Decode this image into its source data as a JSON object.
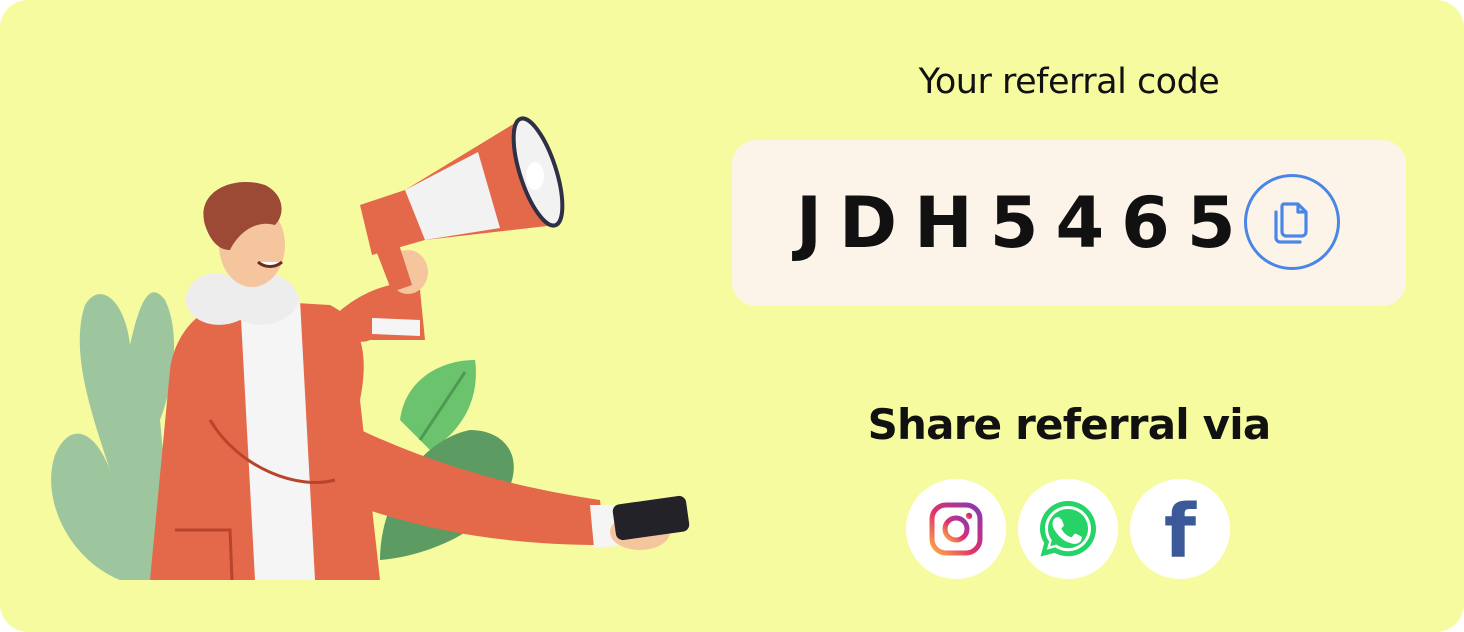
{
  "referral": {
    "heading": "Your referral code",
    "code": "JDH5465",
    "copy_icon": "copy-icon"
  },
  "share": {
    "heading": "Share referral via",
    "items": [
      {
        "name": "instagram",
        "icon": "instagram-icon",
        "color": "#E1306C"
      },
      {
        "name": "whatsapp",
        "icon": "whatsapp-icon",
        "color": "#25D366"
      },
      {
        "name": "facebook",
        "icon": "facebook-icon",
        "glyph": "f",
        "color": "#3B5998"
      }
    ]
  },
  "colors": {
    "background": "#F7FB9F",
    "code_box": "#FDF4E9",
    "accent_blue": "#4A86E8",
    "jacket": "#E4694A",
    "leaf_light": "#9DC69F",
    "leaf_green": "#6CC36E",
    "leaf_dark": "#5C9B61"
  }
}
